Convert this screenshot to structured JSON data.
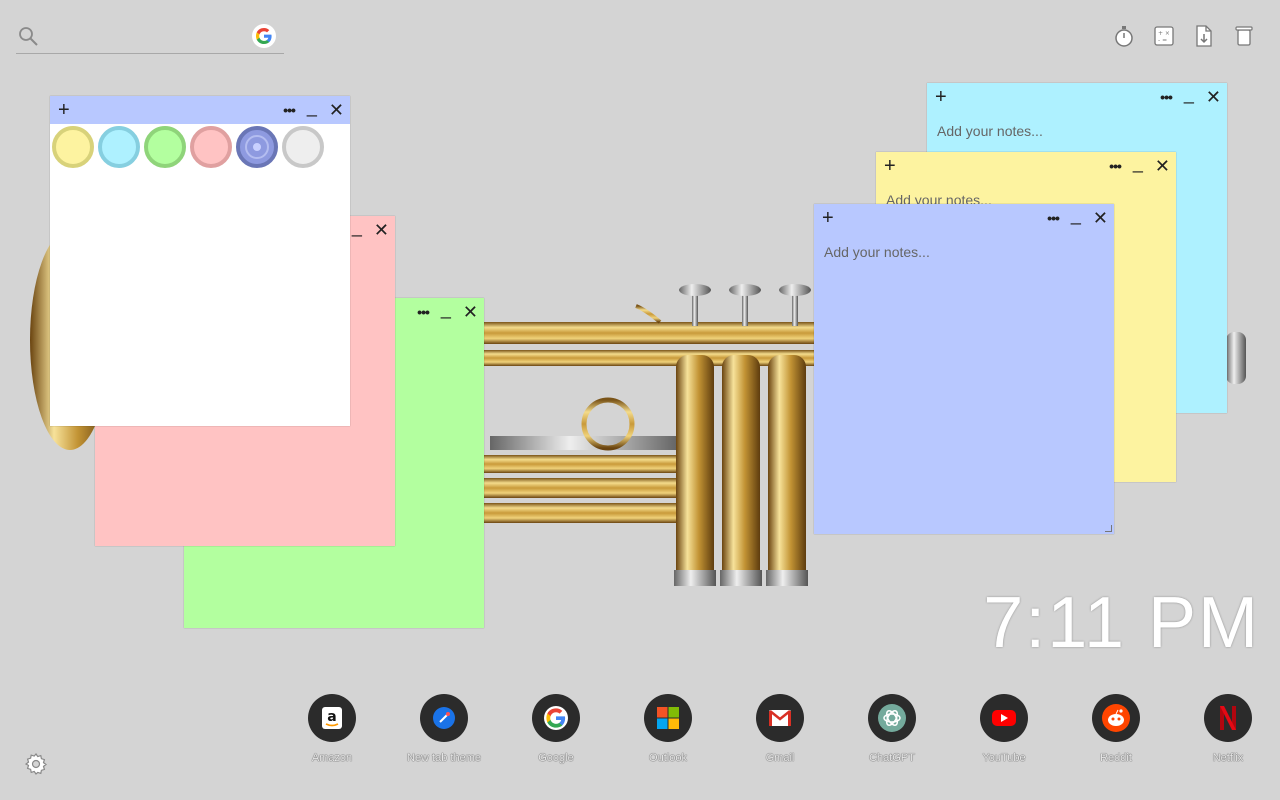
{
  "search": {
    "placeholder": "",
    "value": "",
    "icon": "search-icon",
    "engine_icon": "google-icon"
  },
  "toolbar": {
    "items": [
      {
        "name": "timer-icon"
      },
      {
        "name": "calculator-icon"
      },
      {
        "name": "file-icon"
      },
      {
        "name": "trash-icon"
      }
    ]
  },
  "notes": {
    "placeholder": "Add your notes...",
    "add_label": "+",
    "menu_label": "•••",
    "minimize_label": "_",
    "close_label": "✕",
    "colors": {
      "white": "#ffffff",
      "pink": "#ffc3c3",
      "green": "#b3ff9f",
      "blue": "#b8c8ff",
      "yellow": "#fdf3a0",
      "cyan": "#aef1ff"
    },
    "palette": [
      {
        "name": "yellow",
        "fill": "#fdf3a0",
        "ring": "#d8d27a"
      },
      {
        "name": "cyan",
        "fill": "#aef1ff",
        "ring": "#86cfe0"
      },
      {
        "name": "green",
        "fill": "#b3ff9f",
        "ring": "#8fd47a"
      },
      {
        "name": "pink",
        "fill": "#ffc3c3",
        "ring": "#e0a0a0"
      },
      {
        "name": "blue",
        "fill": "#8e9ae0",
        "ring": "#6a76b6",
        "selected": true
      },
      {
        "name": "gray",
        "fill": "#eeeeee",
        "ring": "#c8c8c8"
      }
    ]
  },
  "clock": {
    "time": "7:11 PM"
  },
  "shortcuts": [
    {
      "label": "Amazon",
      "icon": "amazon-icon"
    },
    {
      "label": "New tab theme",
      "icon": "new-tab-theme-icon"
    },
    {
      "label": "Google",
      "icon": "google-icon"
    },
    {
      "label": "Outlook",
      "icon": "outlook-icon"
    },
    {
      "label": "Gmail",
      "icon": "gmail-icon"
    },
    {
      "label": "ChatGPT",
      "icon": "chatgpt-icon"
    },
    {
      "label": "YouTube",
      "icon": "youtube-icon"
    },
    {
      "label": "Reddit",
      "icon": "reddit-icon"
    },
    {
      "label": "Netflix",
      "icon": "netflix-icon"
    }
  ],
  "settings": {
    "icon": "gear-icon"
  }
}
